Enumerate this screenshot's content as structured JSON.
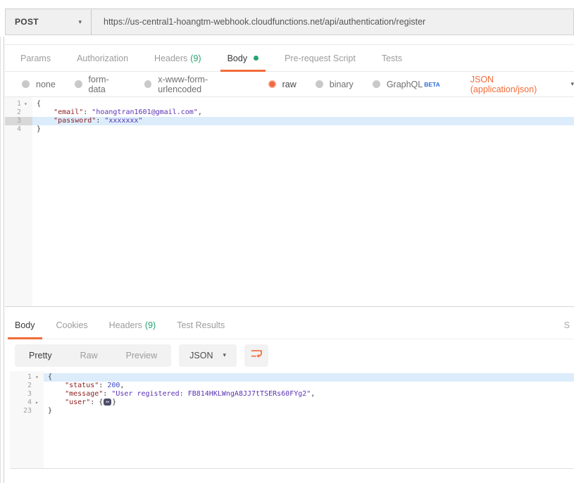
{
  "request": {
    "method": "POST",
    "url": "https://us-central1-hoangtm-webhook.cloudfunctions.net/api/authentication/register",
    "tabs": [
      {
        "label": "Params"
      },
      {
        "label": "Authorization"
      },
      {
        "label": "Headers",
        "badge": "(9)"
      },
      {
        "label": "Body",
        "active": true
      },
      {
        "label": "Pre-request Script"
      },
      {
        "label": "Tests"
      }
    ],
    "body_types": [
      {
        "label": "none"
      },
      {
        "label": "form-data"
      },
      {
        "label": "x-www-form-urlencoded"
      },
      {
        "label": "raw",
        "selected": true
      },
      {
        "label": "binary"
      },
      {
        "label": "GraphQL",
        "beta": "BETA"
      }
    ],
    "content_type": "JSON (application/json)"
  },
  "response": {
    "tabs": [
      {
        "label": "Body",
        "active": true
      },
      {
        "label": "Cookies"
      },
      {
        "label": "Headers",
        "badge": "(9)"
      },
      {
        "label": "Test Results"
      }
    ],
    "status_clipped": "S",
    "view_modes": [
      {
        "label": "Pretty",
        "active": true
      },
      {
        "label": "Raw"
      },
      {
        "label": "Preview"
      }
    ],
    "language": "JSON"
  },
  "editors": {
    "request": {
      "lines": [
        {
          "num": "1",
          "fold": "open",
          "tokens": [
            {
              "c": "p",
              "t": "{"
            }
          ]
        },
        {
          "num": "2",
          "tokens": [
            {
              "c": "p",
              "t": "    "
            },
            {
              "c": "k",
              "t": "\"email\""
            },
            {
              "c": "p",
              "t": ": "
            },
            {
              "c": "s",
              "t": "\"hoangtran1601@gmail.com\""
            },
            {
              "c": "p",
              "t": ","
            }
          ]
        },
        {
          "num": "3",
          "active": true,
          "gactive": true,
          "tokens": [
            {
              "c": "p",
              "t": "    "
            },
            {
              "c": "k",
              "t": "\"password\""
            },
            {
              "c": "p",
              "t": ": "
            },
            {
              "c": "s",
              "t": "\"xxxxxxx\""
            }
          ]
        },
        {
          "num": "4",
          "tokens": [
            {
              "c": "p",
              "t": "}"
            }
          ]
        }
      ]
    },
    "response": {
      "lines": [
        {
          "num": "1",
          "fold": "open",
          "active": true,
          "tokens": [
            {
              "c": "p",
              "t": "{"
            }
          ]
        },
        {
          "num": "2",
          "tokens": [
            {
              "c": "p",
              "t": "    "
            },
            {
              "c": "k",
              "t": "\"status\""
            },
            {
              "c": "p",
              "t": ": "
            },
            {
              "c": "n",
              "t": "200"
            },
            {
              "c": "p",
              "t": ","
            }
          ]
        },
        {
          "num": "3",
          "tokens": [
            {
              "c": "p",
              "t": "    "
            },
            {
              "c": "k",
              "t": "\"message\""
            },
            {
              "c": "p",
              "t": ": "
            },
            {
              "c": "s",
              "t": "\"User registered: FB814HKLWngA8JJ7tTSERs60FYg2\""
            },
            {
              "c": "p",
              "t": ","
            }
          ]
        },
        {
          "num": "4",
          "fold": "closed",
          "tokens": [
            {
              "c": "p",
              "t": "    "
            },
            {
              "c": "k",
              "t": "\"user\""
            },
            {
              "c": "p",
              "t": ": "
            },
            {
              "c": "p",
              "t": "{"
            },
            {
              "c": "f",
              "t": "↔"
            },
            {
              "c": "p",
              "t": "}"
            }
          ]
        },
        {
          "num": "23",
          "tokens": [
            {
              "c": "p",
              "t": "}"
            }
          ]
        }
      ]
    }
  },
  "icons": {
    "method_caret": "▾",
    "content_type_caret": "▾",
    "language_caret": "▾"
  },
  "colors": {
    "accent_orange": "#f26b3a",
    "badge_green": "#23a46f",
    "beta_blue": "#2f6fdb",
    "json_key": "#8b2121",
    "json_string": "#5b32b4",
    "json_number": "#3b47c4",
    "active_line": "#dcecfb"
  }
}
